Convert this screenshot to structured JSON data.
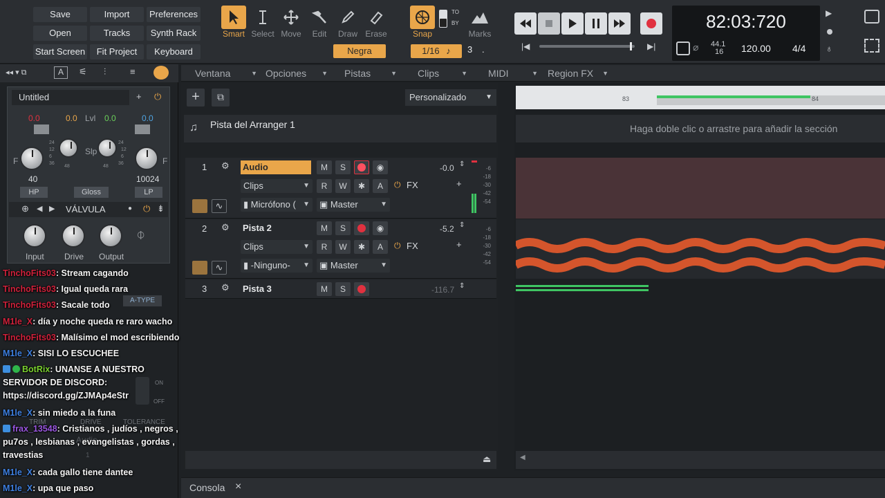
{
  "top_menu": {
    "save": "Save",
    "import": "Import",
    "preferences": "Preferences",
    "open": "Open",
    "tracks": "Tracks",
    "synth_rack": "Synth Rack",
    "start_screen": "Start Screen",
    "fit_project": "Fit Project",
    "keyboard": "Keyboard"
  },
  "tools": {
    "smart": "Smart",
    "select": "Select",
    "move": "Move",
    "edit": "Edit",
    "draw": "Draw",
    "erase": "Erase",
    "snap": "Snap",
    "marks": "Marks",
    "note_value": "Negra",
    "snap_value": "1/16",
    "snap_extra": "3",
    "snap_dot": ".",
    "to": "TO",
    "by": "BY"
  },
  "transport": {
    "time": "82:03:720",
    "sample_rate_top": "44.1",
    "sample_rate_bottom": "16",
    "tempo": "120.00",
    "signature": "4/4"
  },
  "left_panel": {
    "preset_name": "Untitled",
    "val_left": "0.0",
    "val_mid1": "0.0",
    "lvl_label": "Lvl",
    "val_mid2": "0.0",
    "val_right": "0.0",
    "slp_label": "Slp",
    "f_left": "F",
    "f_right": "F",
    "hp_value": "40",
    "lp_value": "10024",
    "hp_label": "HP",
    "gloss_label": "Gloss",
    "lp_label": "LP",
    "scale_left": [
      "24",
      "12",
      "6",
      "36",
      "48"
    ],
    "scale_right": [
      "24",
      "12",
      "6",
      "36",
      "48"
    ],
    "module_name": "VÁLVULA",
    "input_label": "Input",
    "drive_label": "Drive",
    "output_label": "Output",
    "a_type": "A-TYPE",
    "trim": "TRIM",
    "drive2": "DRIVE",
    "tolerance": "TOLERANCE",
    "on": "ON",
    "off": "OFF",
    "audio_bg": "Audio",
    "one_bg": "1"
  },
  "chat": [
    {
      "user": "TinchoFits03",
      "color": "red",
      "msg": ": Stream cagando"
    },
    {
      "user": "TinchoFits03",
      "color": "red",
      "msg": ": Igual queda rara"
    },
    {
      "user": "TinchoFits03",
      "color": "red",
      "msg": ": Sacale todo"
    },
    {
      "user": "M1le_X",
      "color": "red",
      "msg": ": día y noche queda re raro wacho"
    },
    {
      "user": "TinchoFits03",
      "color": "red",
      "msg": ": Malísimo el mod escribiendo"
    },
    {
      "user": "M1le_X",
      "color": "blue",
      "msg": ": SISI LO ESCUCHEE"
    },
    {
      "user": "BotRix",
      "color": "green",
      "msg": ": UNANSE A NUESTRO SERVIDOR DE DISCORD: https://discord.gg/ZJMAp4eStr"
    },
    {
      "user": "M1le_X",
      "color": "blue",
      "msg": ": sin miedo a la funa"
    },
    {
      "user": "frax_13548",
      "color": "purple",
      "msg": ": Cristianos , judíos , negros , pu7os , lesbianas , evangelistas , gordas , travestias"
    },
    {
      "user": "M1le_X",
      "color": "blue",
      "msg": ": cada gallo tiene dantee"
    },
    {
      "user": "M1le_X",
      "color": "blue",
      "msg": ": upa que paso"
    }
  ],
  "menubar": {
    "ventana": "Ventana",
    "opciones": "Opciones",
    "pistas": "Pistas",
    "clips": "Clips",
    "midi": "MIDI",
    "region_fx": "Region FX"
  },
  "arranger": {
    "view_select": "Personalizado",
    "track_name": "Pista del Arranger 1",
    "hint": "Haga doble clic o arrastre para añadir la sección",
    "ruler_83": "83",
    "ruler_84": "84"
  },
  "tracks": [
    {
      "num": "1",
      "name": "Audio",
      "volume": "-0.0",
      "clips": "Clips",
      "input": "Micrófono (",
      "output": "Master",
      "fx": "FX"
    },
    {
      "num": "2",
      "name": "Pista 2",
      "volume": "-5.2",
      "clips": "Clips",
      "input": "-Ninguno-",
      "output": "Master",
      "fx": "FX"
    },
    {
      "num": "3",
      "name": "Pista 3",
      "volume": "-116.7"
    }
  ],
  "track_btns": {
    "m": "M",
    "s": "S",
    "r": "R",
    "w": "W",
    "a": "A"
  },
  "meter_scale": [
    "-6",
    "-18",
    "-30",
    "-42",
    "-54"
  ],
  "console": {
    "label": "Consola",
    "close": "×"
  },
  "colors": {
    "accent": "#e9a64a",
    "record": "#e0313f",
    "waveform": "#d4552c",
    "midi_clip": "#3fc563",
    "track1_clip_bg": "#4a3337"
  }
}
